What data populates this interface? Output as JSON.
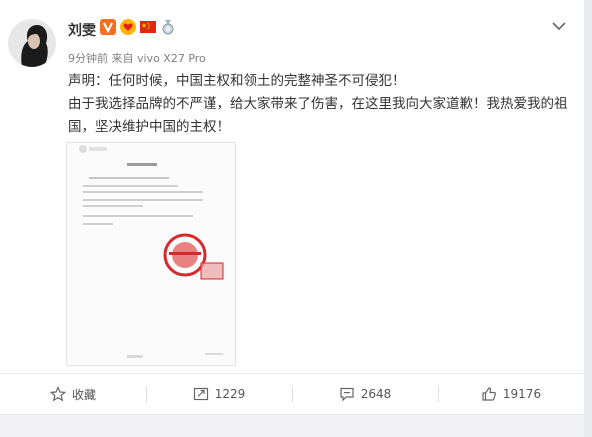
{
  "post": {
    "author": "刘雯",
    "meta": "9分钟前  来自 vivo X27 Pro",
    "lines": [
      "声明：任何时候，中国主权和领土的完整神圣不可侵犯！",
      "由于我选择品牌的不严谨，给大家带来了伤害，在这里我向大家道歉！我热爱我的祖国，坚决维护中国的主权！"
    ]
  },
  "badges": [
    "verified-v-icon",
    "heart-icon",
    "china-flag-icon",
    "medal-icon"
  ],
  "actions": {
    "favorite_label": "收藏",
    "repost_count": "1229",
    "comment_count": "2648",
    "like_count": "19176"
  },
  "colors": {
    "accent": "#f36f21",
    "flag_red": "#de2910",
    "stamp_red": "#d6292c",
    "text": "#333333",
    "meta": "#808080"
  }
}
